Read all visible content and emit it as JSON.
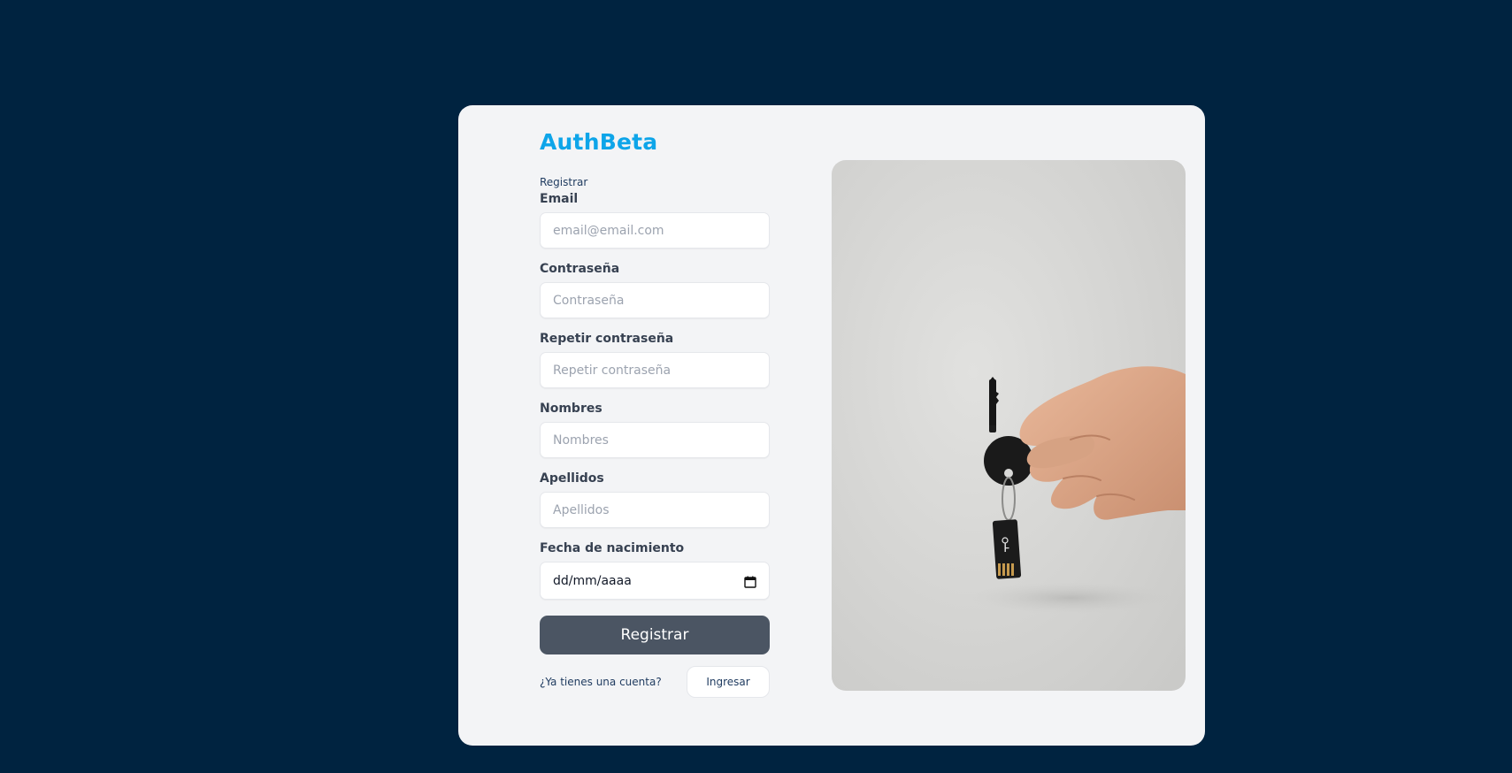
{
  "brand": {
    "name": "AuthBeta"
  },
  "form": {
    "subtitle": "Registrar",
    "fields": {
      "email": {
        "label": "Email",
        "placeholder": "email@email.com"
      },
      "password": {
        "label": "Contraseña",
        "placeholder": "Contraseña"
      },
      "repeat_password": {
        "label": "Repetir contraseña",
        "placeholder": "Repetir contraseña"
      },
      "names": {
        "label": "Nombres",
        "placeholder": "Nombres"
      },
      "surnames": {
        "label": "Apellidos",
        "placeholder": "Apellidos"
      },
      "birthdate": {
        "label": "Fecha de nacimiento",
        "value": "dd/mm/aaaa",
        "icon": "calendar-icon"
      }
    },
    "submit_label": "Registrar",
    "footer": {
      "prompt": "¿Ya tienes una cuenta?",
      "login_label": "Ingresar"
    }
  },
  "image": {
    "description_icon": "hand-holding-key-image"
  },
  "colors": {
    "page_background": "#002340",
    "card_background": "#f3f4f6",
    "brand": "#0ea5e9",
    "submit_button": "#4b5563"
  }
}
